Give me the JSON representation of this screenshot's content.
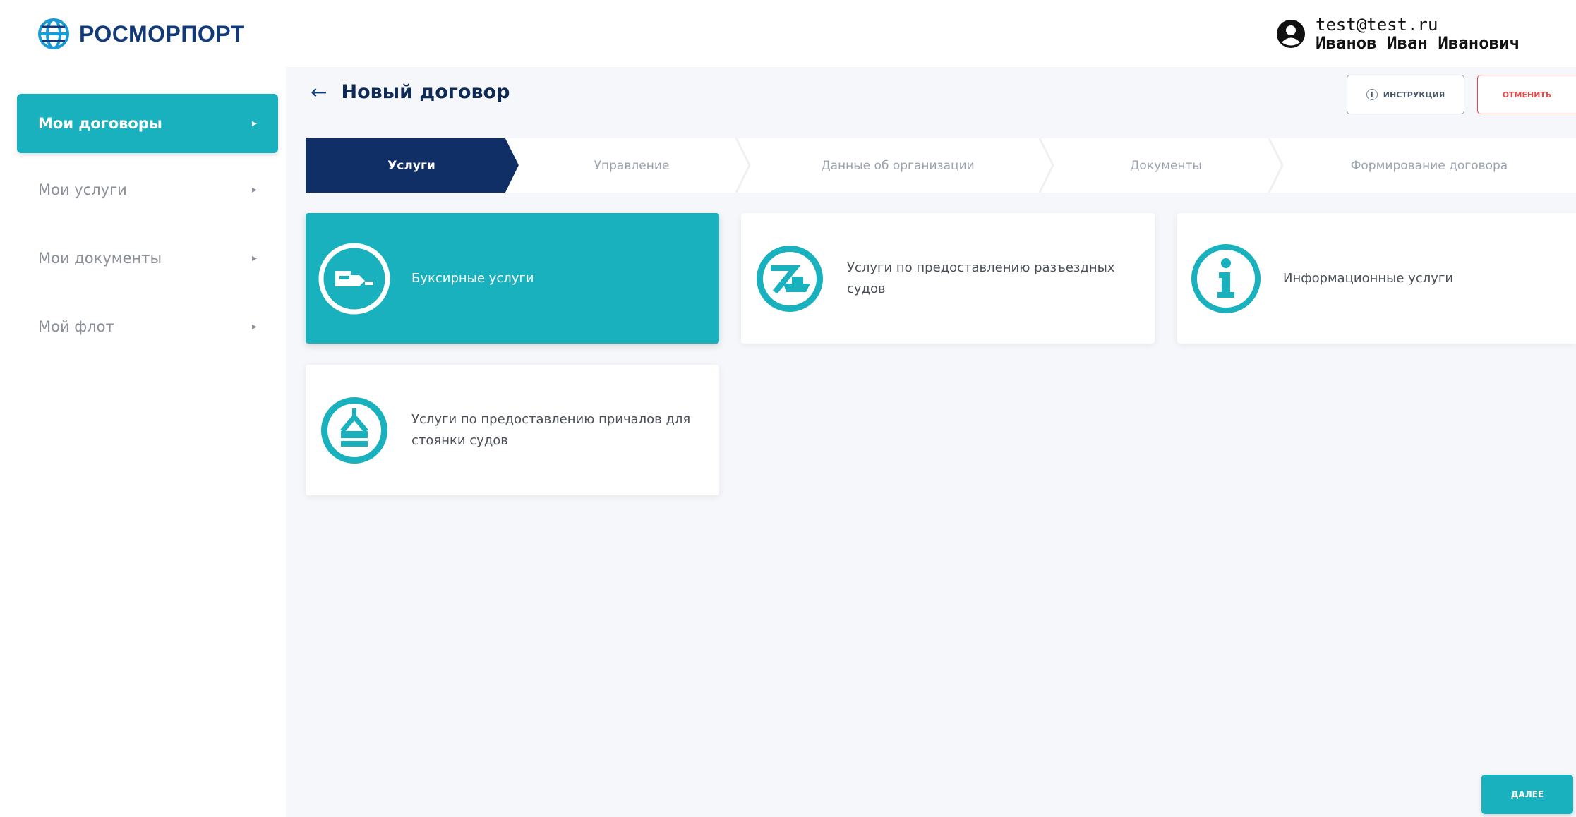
{
  "brand": {
    "name": "РОСМОРПОРТ"
  },
  "user": {
    "email": "test@test.ru",
    "name": "Иванов Иван Иванович"
  },
  "sidebar": {
    "items": [
      {
        "label": "Мои договоры",
        "active": true
      },
      {
        "label": "Мои услуги",
        "active": false
      },
      {
        "label": "Мои документы",
        "active": false
      },
      {
        "label": "Мой флот",
        "active": false
      }
    ]
  },
  "header": {
    "title": "Новый договор",
    "instructions_label": "инструкция",
    "cancel_label": "отменить"
  },
  "steps": [
    {
      "label": "Услуги",
      "active": true
    },
    {
      "label": "Управление",
      "active": false
    },
    {
      "label": "Данные об организации",
      "active": false
    },
    {
      "label": "Документы",
      "active": false
    },
    {
      "label": "Формирование договора",
      "active": false
    }
  ],
  "services": [
    {
      "label": "Буксирные услуги",
      "icon": "tugboat-icon",
      "selected": true
    },
    {
      "label": "Услуги по предоставлению разъездных судов",
      "icon": "ship-icon",
      "selected": false
    },
    {
      "label": "Информационные услуги",
      "icon": "info-icon",
      "selected": false
    },
    {
      "label": "Услуги по предоставлению причалов для стоянки судов",
      "icon": "berth-icon",
      "selected": false
    }
  ],
  "footer": {
    "next_label": "далее"
  },
  "colors": {
    "accent": "#18b1bd",
    "navy": "#0f2f66",
    "danger": "#e64a4a"
  }
}
